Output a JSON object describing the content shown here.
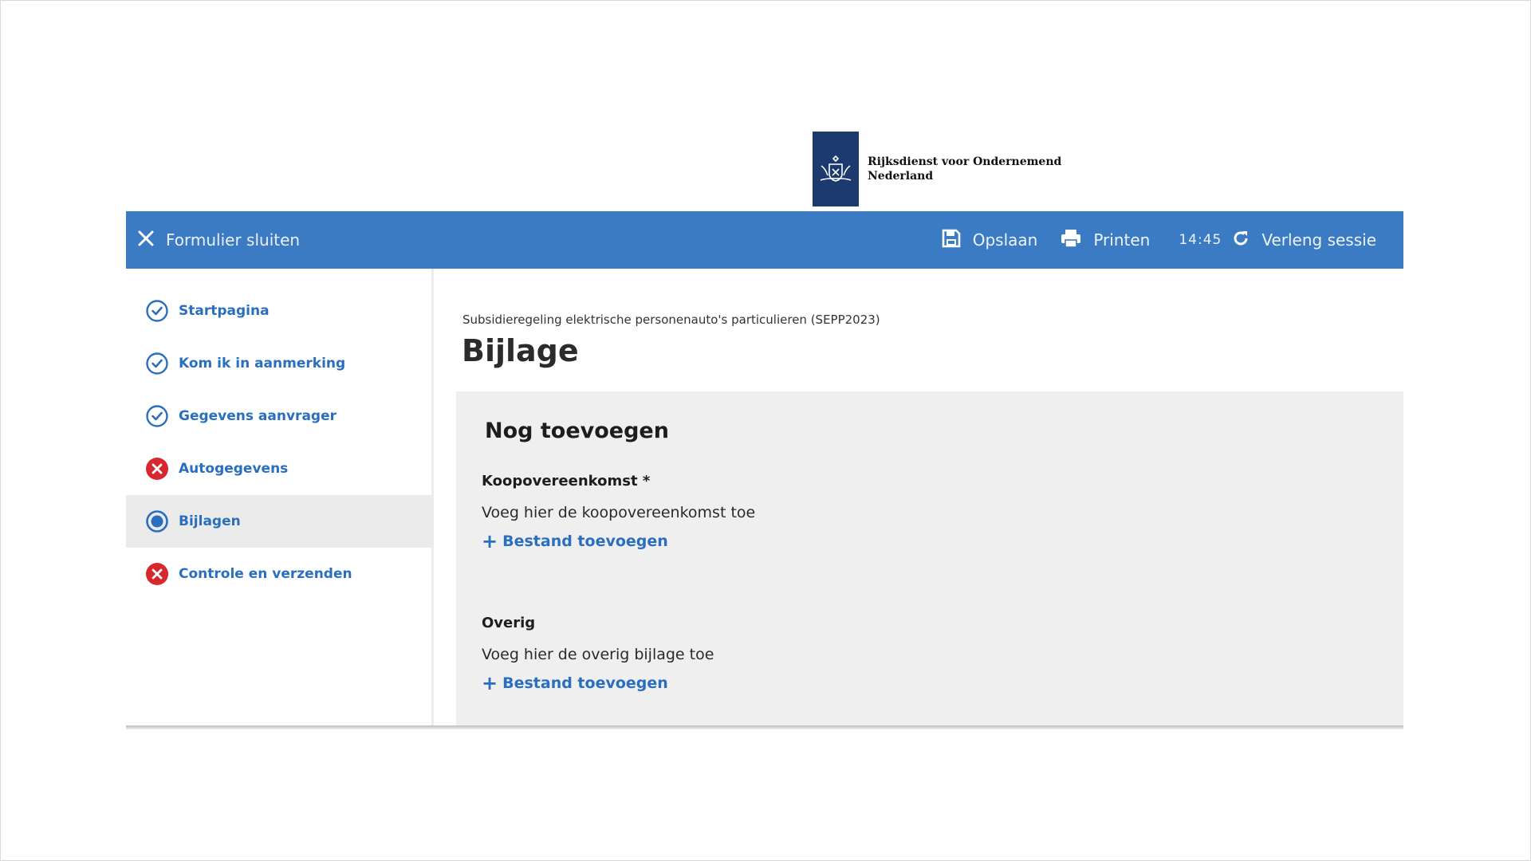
{
  "logo": {
    "line1": "Rijksdienst voor Ondernemend",
    "line2": "Nederland"
  },
  "topbar": {
    "close_label": "Formulier sluiten",
    "save_label": "Opslaan",
    "print_label": "Printen",
    "time": "14:45",
    "extend_label": "Verleng sessie",
    "bg_color": "#3b7bc4"
  },
  "sidebar": {
    "items": [
      {
        "label": "Startpagina",
        "status": "completed"
      },
      {
        "label": "Kom ik in aanmerking",
        "status": "completed"
      },
      {
        "label": "Gegevens aanvrager",
        "status": "completed"
      },
      {
        "label": "Autogegevens",
        "status": "error"
      },
      {
        "label": "Bijlagen",
        "status": "current"
      },
      {
        "label": "Controle en verzenden",
        "status": "error"
      }
    ]
  },
  "main": {
    "subtitle": "Subsidieregeling elektrische personenauto's particulieren (SEPP2023)",
    "title": "Bijlage",
    "panel": {
      "title": "Nog toevoegen",
      "fields": [
        {
          "label": "Koopovereenkomst *",
          "description": "Voeg hier de koopovereenkomst toe",
          "add_label": "Bestand toevoegen"
        },
        {
          "label": "Overig",
          "description": "Voeg hier de overig bijlage toe",
          "add_label": "Bestand toevoegen"
        }
      ]
    }
  },
  "colors": {
    "link": "#2a6fbf",
    "error": "#d7282f",
    "panel_bg": "#efefef"
  }
}
